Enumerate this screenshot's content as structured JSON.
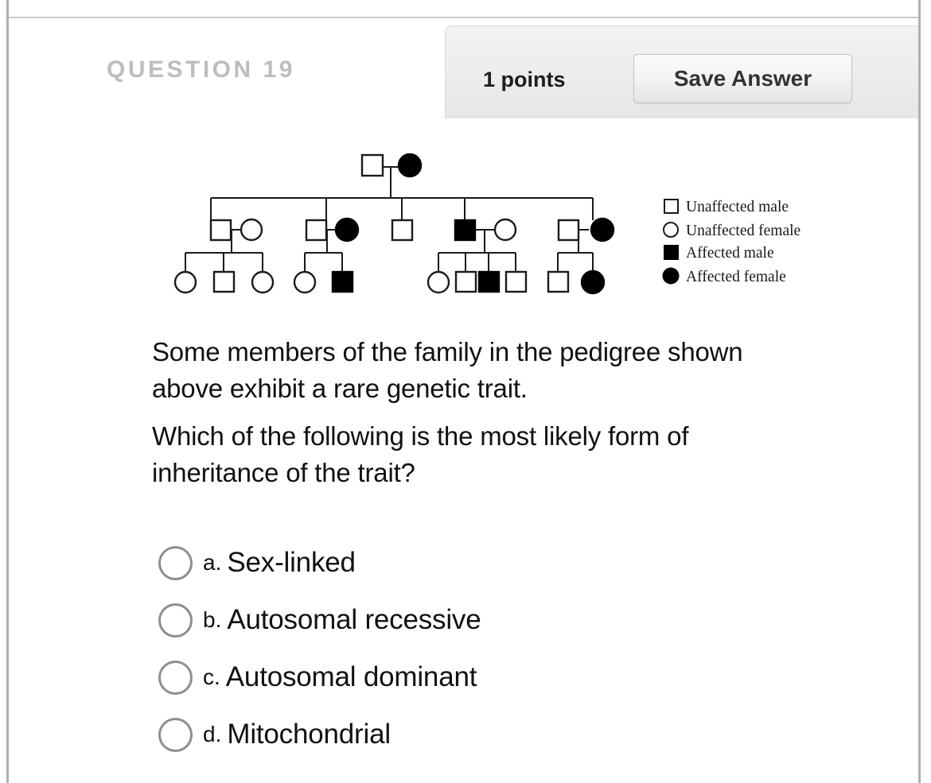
{
  "header": {
    "question_title": "QUESTION 19",
    "points_label": "1 points",
    "save_button_label": "Save Answer"
  },
  "pedigree": {
    "legend": [
      {
        "symbol": "unfilled-square",
        "label": "Unaffected male"
      },
      {
        "symbol": "unfilled-circle",
        "label": "Unaffected female"
      },
      {
        "symbol": "filled-square",
        "label": "Affected male"
      },
      {
        "symbol": "filled-circle",
        "label": "Affected female"
      }
    ],
    "generations": [
      {
        "generation": 1,
        "individuals": [
          {
            "id": "I-1",
            "sex": "male",
            "affected": false
          },
          {
            "id": "I-2",
            "sex": "female",
            "affected": true
          }
        ]
      },
      {
        "generation": 2,
        "individuals": [
          {
            "id": "II-1",
            "sex": "male",
            "affected": false,
            "child_of_gen1": true
          },
          {
            "id": "II-2",
            "sex": "female",
            "affected": false,
            "married_in": true
          },
          {
            "id": "II-3",
            "sex": "male",
            "affected": false,
            "married_in": true
          },
          {
            "id": "II-4",
            "sex": "female",
            "affected": true,
            "child_of_gen1": true
          },
          {
            "id": "II-5",
            "sex": "male",
            "affected": false,
            "child_of_gen1": true
          },
          {
            "id": "II-6",
            "sex": "male",
            "affected": true,
            "child_of_gen1": true
          },
          {
            "id": "II-7",
            "sex": "female",
            "affected": false,
            "married_in": true
          },
          {
            "id": "II-8",
            "sex": "male",
            "affected": false,
            "married_in": true
          },
          {
            "id": "II-9",
            "sex": "female",
            "affected": true,
            "child_of_gen1": true
          }
        ]
      },
      {
        "generation": 3,
        "individuals": [
          {
            "id": "III-1",
            "sex": "female",
            "affected": false
          },
          {
            "id": "III-2",
            "sex": "male",
            "affected": false
          },
          {
            "id": "III-3",
            "sex": "female",
            "affected": false
          },
          {
            "id": "III-4",
            "sex": "female",
            "affected": false
          },
          {
            "id": "III-5",
            "sex": "male",
            "affected": true
          },
          {
            "id": "III-6",
            "sex": "female",
            "affected": false
          },
          {
            "id": "III-7",
            "sex": "male",
            "affected": false
          },
          {
            "id": "III-8",
            "sex": "male",
            "affected": true
          },
          {
            "id": "III-9",
            "sex": "male",
            "affected": false
          },
          {
            "id": "III-10",
            "sex": "male",
            "affected": false
          },
          {
            "id": "III-11",
            "sex": "female",
            "affected": true
          }
        ]
      }
    ]
  },
  "question": {
    "paragraph_1": "Some members of the family in the pedigree shown above exhibit a rare genetic trait.",
    "paragraph_2": "Which of the following is the most likely form of inheritance of the trait?"
  },
  "answers": [
    {
      "letter": "a.",
      "label": "Sex-linked",
      "selected": false
    },
    {
      "letter": "b.",
      "label": "Autosomal recessive",
      "selected": false
    },
    {
      "letter": "c.",
      "label": "Autosomal dominant",
      "selected": false
    },
    {
      "letter": "d.",
      "label": "Mitochondrial",
      "selected": false
    }
  ],
  "colors": {
    "affected_fill": "#000000",
    "unaffected_fill": "#ffffff",
    "stroke": "#1a1a1a",
    "title_gray": "#bdbdbd",
    "radio_gray": "#8e8e8e"
  }
}
